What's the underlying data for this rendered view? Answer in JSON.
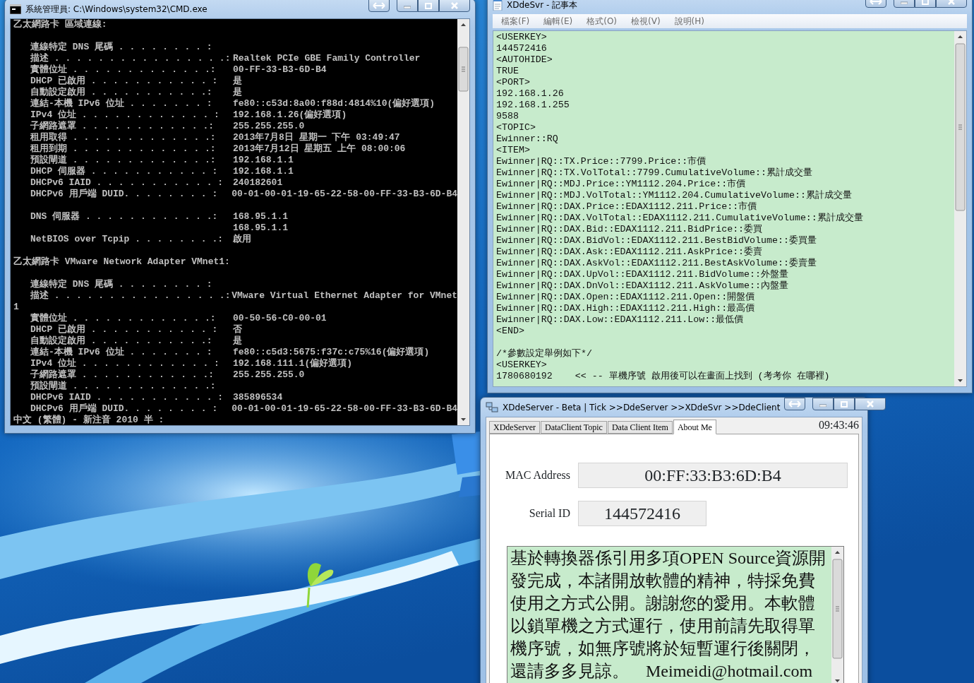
{
  "console_window": {
    "title": "系統管理員: C:\\Windows\\system32\\CMD.exe",
    "adapters": [
      {
        "header": "乙太網路卡 區域連線:",
        "groups": [
          [
            {
              "kind": "field",
              "label": "連線特定 DNS 尾碼 . . . . . . . . :"
            },
            {
              "kind": "field",
              "label": "描述 . . . . . . . . . . . . . . . .:",
              "value": "Realtek PCIe GBE Family Controller"
            },
            {
              "kind": "field",
              "label": "實體位址 . . . . . . . . . . . . .:",
              "value": "00-FF-33-B3-6D-B4"
            },
            {
              "kind": "field",
              "label": "DHCP 已啟用 . . . . . . . . . . . :",
              "value": "是"
            },
            {
              "kind": "field",
              "label": "自動設定啟用 . . . . . . . . . . .:",
              "value": "是"
            },
            {
              "kind": "field",
              "label": "連結-本機 IPv6 位址 . . . . . . . :",
              "value": "fe80::c53d:8a00:f88d:4814%10(偏好選項)"
            },
            {
              "kind": "field",
              "label": "IPv4 位址 . . . . . . . . . . . . :",
              "value": "192.168.1.26(偏好選項)"
            },
            {
              "kind": "field",
              "label": "子網路遮罩 . . . . . . . . . . . .:",
              "value": "255.255.255.0"
            },
            {
              "kind": "field",
              "label": "租用取得 . . . . . . . . . . . . .:",
              "value": "2013年7月8日 星期一 下午 03:49:47"
            },
            {
              "kind": "field",
              "label": "租用到期 . . . . . . . . . . . . .:",
              "value": "2013年7月12日 星期五 上午 08:00:06"
            },
            {
              "kind": "field",
              "label": "預設閘道 . . . . . . . . . . . . .:",
              "value": "192.168.1.1"
            },
            {
              "kind": "field",
              "label": "DHCP 伺服器 . . . . . . . . . . . :",
              "value": "192.168.1.1"
            },
            {
              "kind": "field",
              "label": "DHCPv6 IAID . . . . . . . . . . . :",
              "value": "240182601"
            },
            {
              "kind": "field",
              "label": "DHCPv6 用戶端 DUID. . . . . . . . :",
              "value": "00-01-00-01-19-65-22-58-00-FF-33-B3-6D-B4"
            }
          ],
          [
            {
              "kind": "field",
              "label": "DNS 伺服器 . . . . . . . . . . . .:",
              "value": "168.95.1.1"
            },
            {
              "kind": "continuation",
              "value": "168.95.1.1"
            },
            {
              "kind": "field",
              "label": "NetBIOS over Tcpip . . . . . . . .:",
              "value": "啟用"
            }
          ]
        ]
      },
      {
        "header": "乙太網路卡 VMware Network Adapter VMnet1:",
        "groups": [
          [
            {
              "kind": "field",
              "label": "連線特定 DNS 尾碼 . . . . . . . . :"
            },
            {
              "kind": "field",
              "label": "描述 . . . . . . . . . . . . . . . .:",
              "value": "VMware Virtual Ethernet Adapter for VMnet"
            },
            {
              "kind": "wrap",
              "value": "1"
            },
            {
              "kind": "field",
              "label": "實體位址 . . . . . . . . . . . . .:",
              "value": "00-50-56-C0-00-01"
            },
            {
              "kind": "field",
              "label": "DHCP 已啟用 . . . . . . . . . . . :",
              "value": "否"
            },
            {
              "kind": "field",
              "label": "自動設定啟用 . . . . . . . . . . .:",
              "value": "是"
            },
            {
              "kind": "field",
              "label": "連結-本機 IPv6 位址 . . . . . . . :",
              "value": "fe80::c5d3:5675:f37c:c75%16(偏好選項)"
            },
            {
              "kind": "field",
              "label": "IPv4 位址 . . . . . . . . . . . . :",
              "value": "192.168.111.1(偏好選項)"
            },
            {
              "kind": "field",
              "label": "子網路遮罩 . . . . . . . . . . . .:",
              "value": "255.255.255.0"
            },
            {
              "kind": "field",
              "label": "預設閘道 . . . . . . . . . . . . .:"
            },
            {
              "kind": "field",
              "label": "DHCPv6 IAID . . . . . . . . . . . :",
              "value": "385896534"
            },
            {
              "kind": "field",
              "label": "DHCPv6 用戶端 DUID. . . . . . . . :",
              "value": "00-01-00-01-19-65-22-58-00-FF-33-B3-6D-B4"
            }
          ]
        ]
      }
    ],
    "ime_status": "中文 (繁體) - 新注音 2010 半 :"
  },
  "notepad_window": {
    "title": "XDdeSvr - 記事本",
    "menu": [
      "檔案(F)",
      "編輯(E)",
      "格式(O)",
      "檢視(V)",
      "說明(H)"
    ],
    "blocks": [
      [
        "<USERKEY>",
        "144572416",
        "<AUTOHIDE>",
        "TRUE",
        "<PORT>",
        "192.168.1.26",
        "192.168.1.255",
        "9588",
        "<TOPIC>",
        "Ewinner::RQ",
        "<ITEM>",
        "Ewinner|RQ::TX.Price::7799.Price::市價",
        "Ewinner|RQ::TX.VolTotal::7799.CumulativeVolume::累計成交量",
        "Ewinner|RQ::MDJ.Price::YM1112.204.Price::市價",
        "Ewinner|RQ::MDJ.VolTotal::YM1112.204.CumulativeVolume::累計成交量",
        "Ewinner|RQ::DAX.Price::EDAX1112.211.Price::市價",
        "Ewinner|RQ::DAX.VolTotal::EDAX1112.211.CumulativeVolume::累計成交量",
        "Ewinner|RQ::DAX.Bid::EDAX1112.211.BidPrice::委買",
        "Ewinner|RQ::DAX.BidVol::EDAX1112.211.BestBidVolume::委買量",
        "Ewinner|RQ::DAX.Ask::EDAX1112.211.AskPrice::委賣",
        "Ewinner|RQ::DAX.AskVol::EDAX1112.211.BestAskVolume::委賣量",
        "Ewinner|RQ::DAX.UpVol::EDAX1112.211.BidVolume::外盤量",
        "Ewinner|RQ::DAX.DnVol::EDAX1112.211.AskVolume::內盤量",
        "Ewinner|RQ::DAX.Open::EDAX1112.211.Open::開盤價",
        "Ewinner|RQ::DAX.High::EDAX1112.211.High::最高價",
        "Ewinner|RQ::DAX.Low::EDAX1112.211.Low::最低價",
        "<END>"
      ],
      [
        "/*參數設定舉例如下*/",
        "<USERKEY>",
        "1780680192    << -- 單機序號 啟用後可以在畫面上找到 (考考你 在哪裡)"
      ]
    ]
  },
  "app_window": {
    "title": "XDdeServer - Beta | Tick >>DdeServer >>XDdeSvr >>DdeClient",
    "tabs": [
      {
        "label": "XDdeServer",
        "selected": false
      },
      {
        "label": "DataClient Topic",
        "selected": false
      },
      {
        "label": "Data Client Item",
        "selected": false
      },
      {
        "label": "About Me",
        "selected": true
      }
    ],
    "clock": "09:43:46",
    "fields": [
      {
        "label": "MAC Address",
        "value": "00:FF:33:B3:6D:B4"
      },
      {
        "label": "Serial ID",
        "value": "144572416"
      }
    ],
    "about_text": "基於轉換器係引用多項OPEN Source資源開發完成，本諸開放軟體的精神，特採免費使用之方式公開。謝謝您的愛用。本軟體以鎖單機之方式運行，使用前請先取得單機序號，如無序號將於短暫運行後關閉，還請多多見諒。    Meimeidi@hotmail.com"
  }
}
